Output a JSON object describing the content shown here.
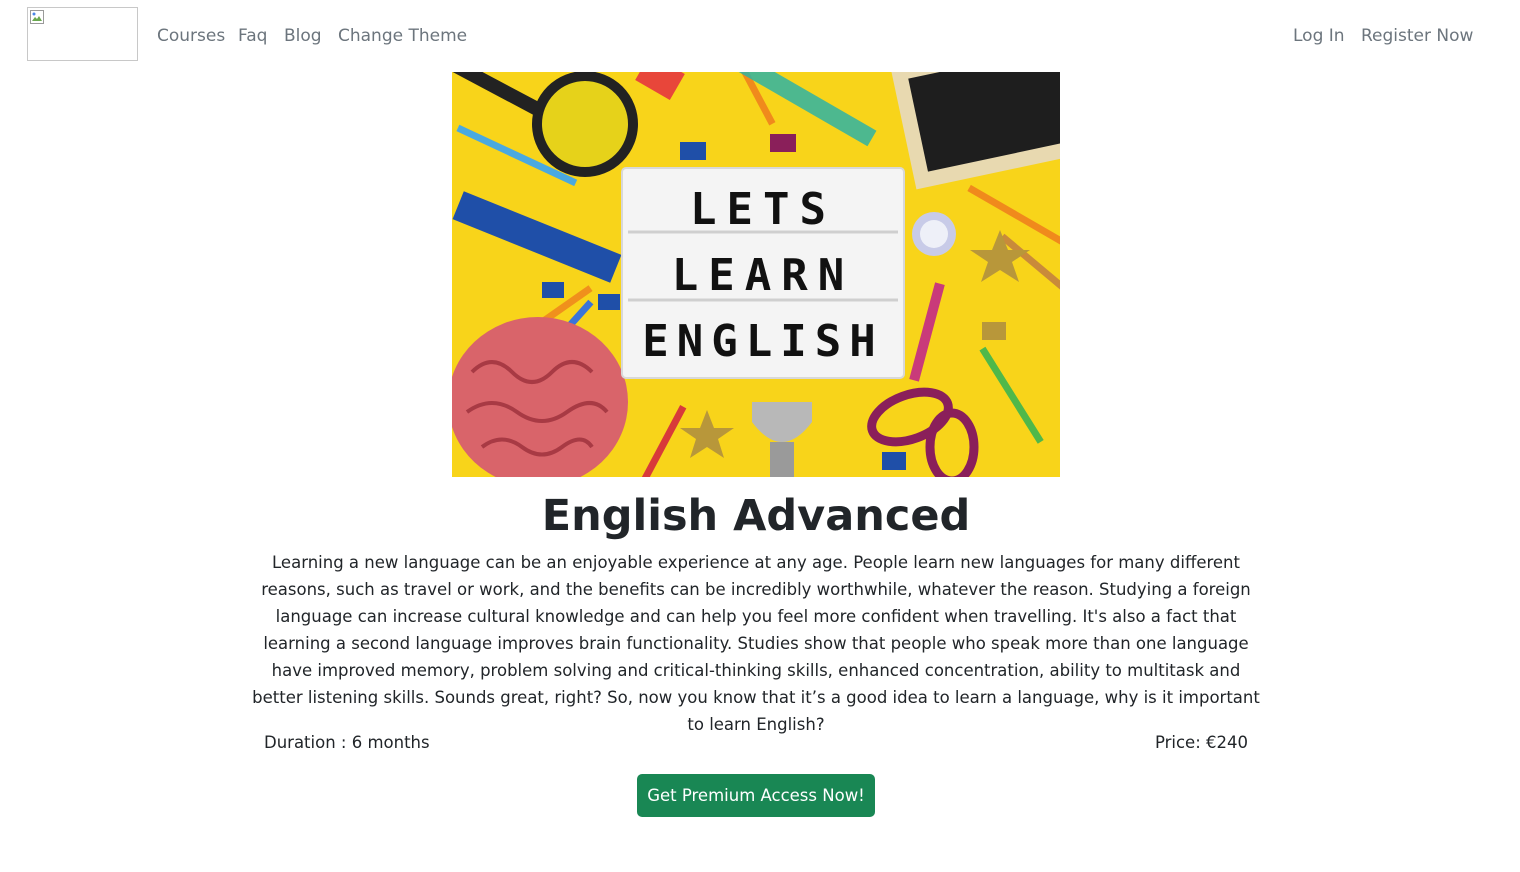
{
  "nav": {
    "items": [
      {
        "label": "Courses"
      },
      {
        "label": "Faq"
      },
      {
        "label": "Blog"
      },
      {
        "label": "Change Theme"
      }
    ],
    "login": "Log In",
    "register": "Register Now"
  },
  "hero": {
    "lightbox_lines": [
      "LETS",
      "LEARN",
      "ENGLISH"
    ]
  },
  "course": {
    "title": "English Advanced",
    "description": "Learning a new language can be an enjoyable experience at any age. People learn new languages for many different reasons, such as travel or work, and the benefits can be incredibly worthwhile, whatever the reason. Studying a foreign language can increase cultural knowledge and can help you feel more confident when travelling. It's also a fact that learning a second language improves brain functionality. Studies show that people who speak more than one language have improved memory, problem solving and critical-thinking skills, enhanced concentration, ability to multitask and better listening skills. Sounds great, right? So, now you know that it’s a good idea to learn a language, why is it important to learn English?",
    "duration": "Duration : 6 months",
    "price": "Price: €240",
    "cta": "Get Premium Access Now!"
  },
  "colors": {
    "nav_link": "#6c757d",
    "cta_bg": "#198754",
    "hero_bg": "#f8d41a",
    "text": "#212529"
  }
}
